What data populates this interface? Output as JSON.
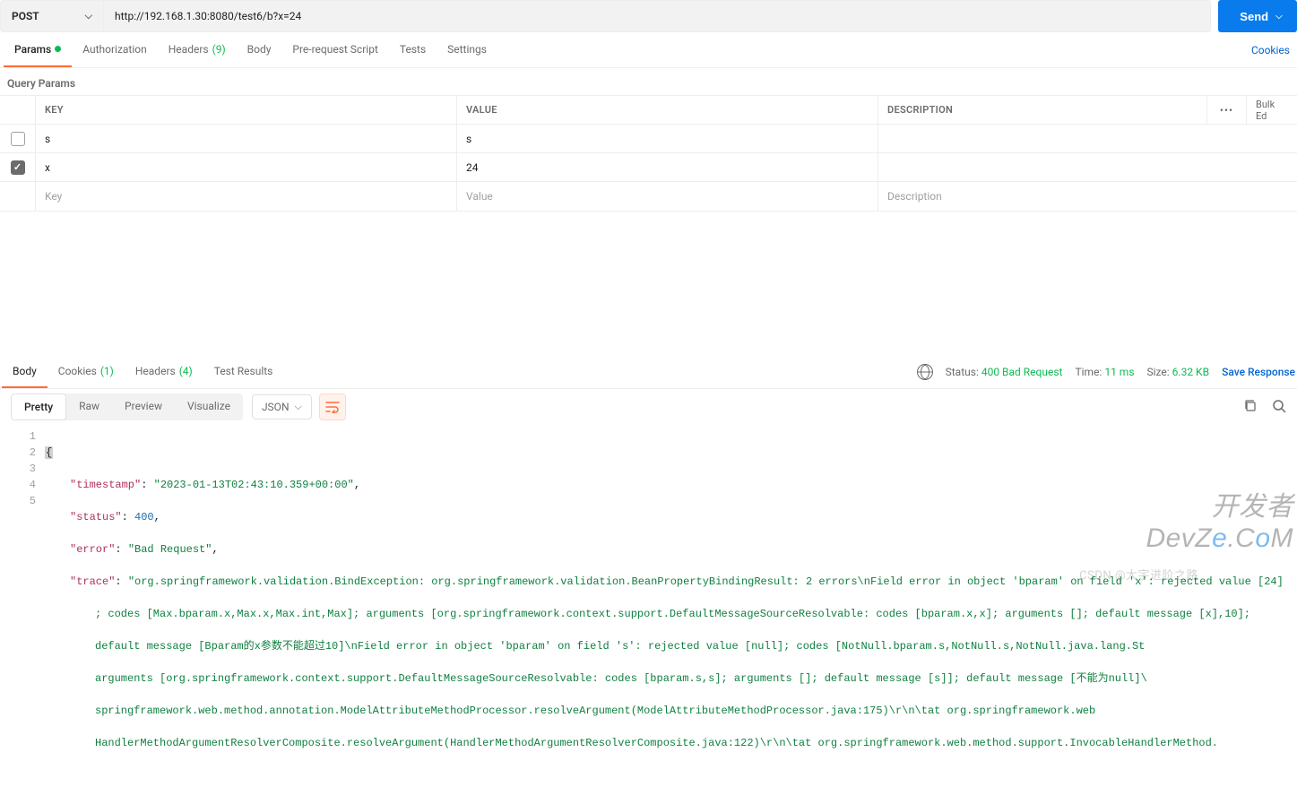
{
  "request": {
    "method": "POST",
    "url": "http://192.168.1.30:8080/test6/b?x=24",
    "sendLabel": "Send"
  },
  "tabs": {
    "params": "Params",
    "authorization": "Authorization",
    "headers": "Headers",
    "headersCount": "(9)",
    "body": "Body",
    "prerequest": "Pre-request Script",
    "tests": "Tests",
    "settings": "Settings",
    "cookies": "Cookies"
  },
  "paramsSection": {
    "title": "Query Params",
    "headKey": "KEY",
    "headValue": "VALUE",
    "headDesc": "DESCRIPTION",
    "bulk": "Bulk Ed",
    "more": "•••",
    "rows": [
      {
        "checked": false,
        "key": "s",
        "value": "s",
        "desc": ""
      },
      {
        "checked": true,
        "key": "x",
        "value": "24",
        "desc": ""
      }
    ],
    "placeholders": {
      "key": "Key",
      "value": "Value",
      "desc": "Description"
    }
  },
  "response": {
    "tabs": {
      "body": "Body",
      "cookies": "Cookies",
      "cookiesCount": "(1)",
      "headers": "Headers",
      "headersCount": "(4)",
      "testResults": "Test Results"
    },
    "meta": {
      "statusLabel": "Status:",
      "statusValue": "400 Bad Request",
      "timeLabel": "Time:",
      "timeValue": "11 ms",
      "sizeLabel": "Size:",
      "sizeValue": "6.32 KB",
      "save": "Save Response"
    },
    "viewModes": {
      "pretty": "Pretty",
      "raw": "Raw",
      "preview": "Preview",
      "visualize": "Visualize",
      "lang": "JSON"
    },
    "json": {
      "openBrace": "{",
      "line2key": "\"timestamp\"",
      "line2val": "\"2023-01-13T02:43:10.359+00:00\"",
      "line3key": "\"status\"",
      "line3val": "400",
      "line4key": "\"error\"",
      "line4val": "\"Bad Request\"",
      "line5key": "\"trace\"",
      "traceA": "\"org.springframework.validation.BindException: org.springframework.validation.BeanPropertyBindingResult: 2 errors\\nField error in object 'bparam' on field 'x': rejected value [24]",
      "traceB": "; codes [Max.bparam.x,Max.x,Max.int,Max]; arguments [org.springframework.context.support.DefaultMessageSourceResolvable: codes [bparam.x,x]; arguments []; default message [x],10]; ",
      "traceC": "default message [Bparam的x参数不能超过10]\\nField error in object 'bparam' on field 's': rejected value [null]; codes [NotNull.bparam.s,NotNull.s,NotNull.java.lang.St",
      "traceD": "arguments [org.springframework.context.support.DefaultMessageSourceResolvable: codes [bparam.s,s]; arguments []; default message [s]]; default message [不能为null]\\",
      "traceE": "springframework.web.method.annotation.ModelAttributeMethodProcessor.resolveArgument(ModelAttributeMethodProcessor.java:175)\\r\\n\\tat org.springframework.web",
      "traceF": "HandlerMethodArgumentResolverComposite.resolveArgument(HandlerMethodArgumentResolverComposite.java:122)\\r\\n\\tat org.springframework.web.method.support.InvocableHandlerMethod."
    }
  },
  "watermark": {
    "big1": "开发者",
    "big2": "DevZ",
    "big3": "e",
    "big4": ".C",
    "big5": "o",
    "big6": "M",
    "csdn": "CSDN @大宇进阶之路"
  }
}
